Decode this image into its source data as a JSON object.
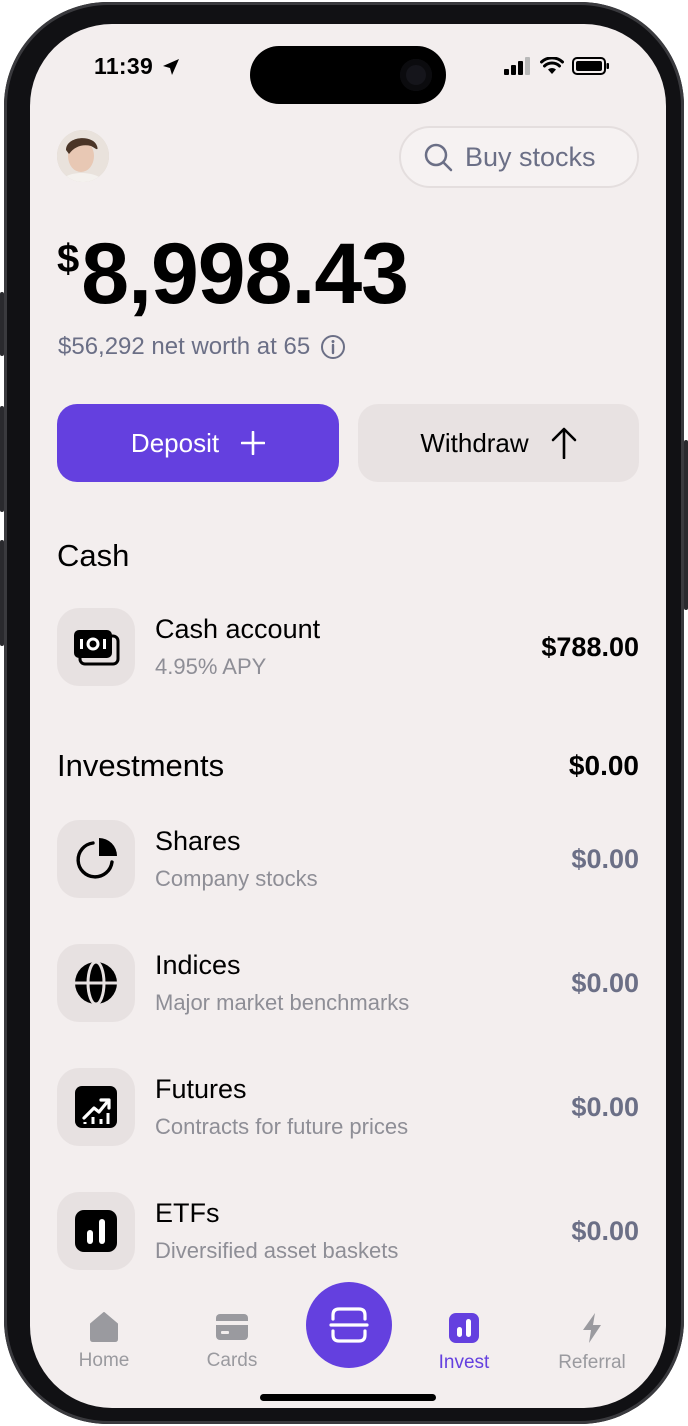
{
  "status": {
    "time": "11:39"
  },
  "header": {
    "search_label": "Buy stocks"
  },
  "balance": {
    "currency": "$",
    "amount": "8,998.43",
    "net_worth": "$56,292 net worth at 65"
  },
  "actions": {
    "deposit": "Deposit",
    "withdraw": "Withdraw"
  },
  "cash": {
    "title": "Cash",
    "account": {
      "name": "Cash account",
      "subtitle": "4.95% APY",
      "value": "$788.00"
    }
  },
  "investments": {
    "title": "Investments",
    "total": "$0.00",
    "items": [
      {
        "name": "Shares",
        "subtitle": "Company stocks",
        "value": "$0.00"
      },
      {
        "name": "Indices",
        "subtitle": "Major market benchmarks",
        "value": "$0.00"
      },
      {
        "name": "Futures",
        "subtitle": "Contracts for future prices",
        "value": "$0.00"
      },
      {
        "name": "ETFs",
        "subtitle": "Diversified asset baskets",
        "value": "$0.00"
      }
    ]
  },
  "tabs": {
    "home": "Home",
    "cards": "Cards",
    "invest": "Invest",
    "referral": "Referral"
  },
  "colors": {
    "accent": "#6440df",
    "background": "#f3eeee",
    "muted": "#6b6f86"
  },
  "icons": [
    "location-arrow-icon",
    "signal-icon",
    "wifi-icon",
    "battery-icon",
    "search-icon",
    "info-icon",
    "plus-icon",
    "arrow-up-icon",
    "cash-icon",
    "pie-chart-icon",
    "globe-icon",
    "trend-up-icon",
    "bar-chart-icon",
    "home-icon",
    "card-icon",
    "scan-icon",
    "bolt-icon"
  ]
}
